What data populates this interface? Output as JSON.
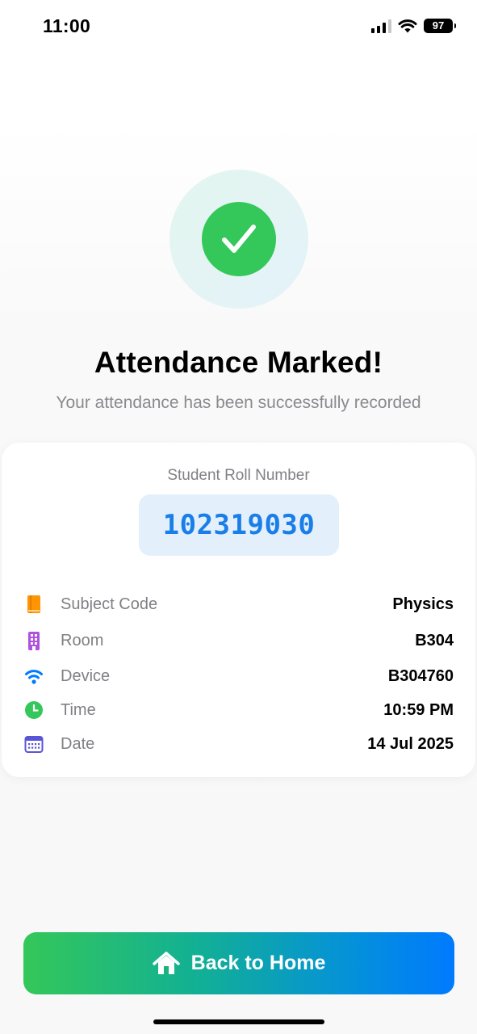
{
  "status_bar": {
    "time": "11:00",
    "battery": "97"
  },
  "success": {
    "title": "Attendance Marked!",
    "subtitle": "Your attendance has been successfully recorded"
  },
  "card": {
    "roll_label": "Student Roll Number",
    "roll_number": "102319030",
    "details": [
      {
        "icon": "book-icon",
        "icon_color": "#ff9500",
        "label": "Subject Code",
        "value": "Physics"
      },
      {
        "icon": "building-icon",
        "icon_color": "#af52de",
        "label": "Room",
        "value": "B304"
      },
      {
        "icon": "wifi-icon",
        "icon_color": "#007aff",
        "label": "Device",
        "value": "B304760"
      },
      {
        "icon": "clock-icon",
        "icon_color": "#34c759",
        "label": "Time",
        "value": "10:59 PM"
      },
      {
        "icon": "calendar-icon",
        "icon_color": "#5856d6",
        "label": "Date",
        "value": "14 Jul 2025"
      }
    ]
  },
  "button": {
    "label": "Back to Home",
    "icon": "house-icon"
  },
  "colors": {
    "success_green": "#34c759",
    "accent_blue": "#007aff",
    "roll_blue": "#1a7ee8"
  }
}
